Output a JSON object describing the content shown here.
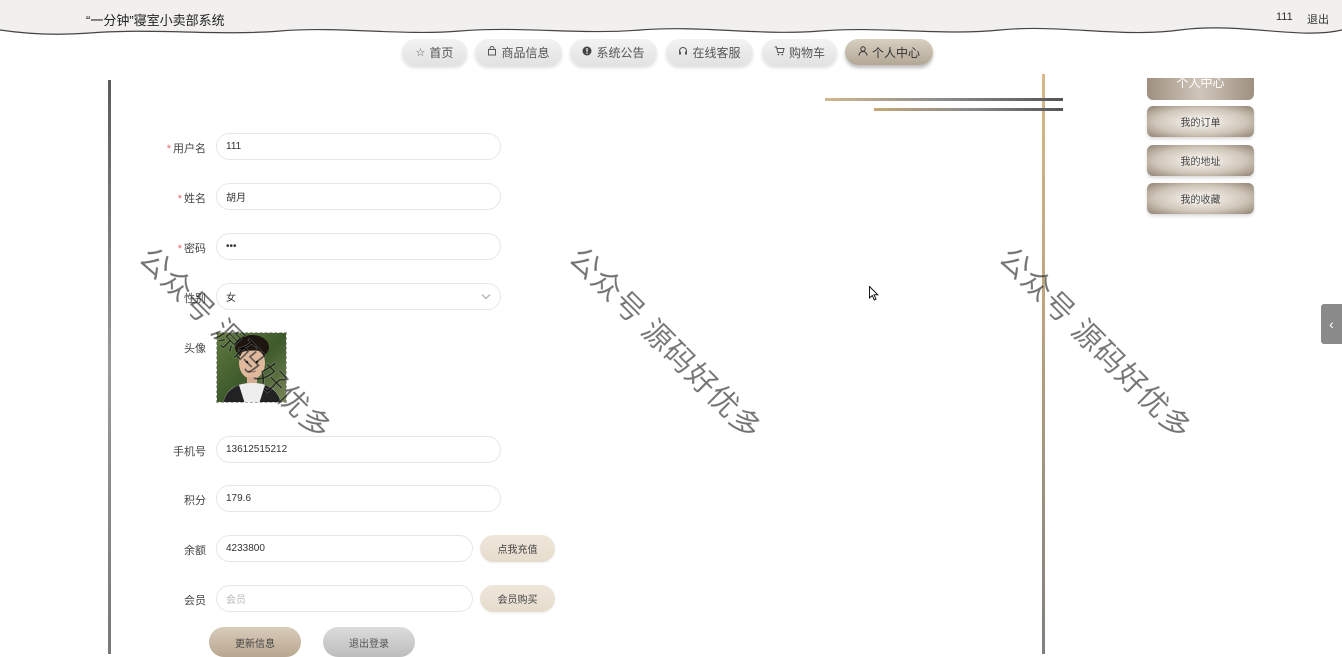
{
  "header": {
    "title": "“一分钟”寝室小卖部系统",
    "user": "111",
    "logout": "退出"
  },
  "nav": [
    {
      "label": "首页",
      "icon": "star-icon",
      "active": false
    },
    {
      "label": "商品信息",
      "icon": "bag-icon",
      "active": false
    },
    {
      "label": "系统公告",
      "icon": "info-icon",
      "active": false
    },
    {
      "label": "在线客服",
      "icon": "headset-icon",
      "active": false
    },
    {
      "label": "购物车",
      "icon": "cart-icon",
      "active": false
    },
    {
      "label": "个人中心",
      "icon": "user-icon",
      "active": true
    }
  ],
  "side_menu": {
    "title": "个人中心",
    "items": [
      "我的订单",
      "我的地址",
      "我的收藏"
    ]
  },
  "form": {
    "username": {
      "label": "用户名",
      "value": "111",
      "required": true
    },
    "name": {
      "label": "姓名",
      "value": "胡月",
      "required": true
    },
    "password": {
      "label": "密码",
      "value": "•••",
      "required": true
    },
    "gender": {
      "label": "性别",
      "value": "女"
    },
    "avatar": {
      "label": "头像"
    },
    "phone": {
      "label": "手机号",
      "value": "13612515212"
    },
    "points": {
      "label": "积分",
      "value": "179.6"
    },
    "balance": {
      "label": "余额",
      "value": "4233800",
      "action": "点我充值"
    },
    "member": {
      "label": "会员",
      "placeholder": "会员",
      "action": "会员购买"
    },
    "update_button": "更新信息",
    "logout_button": "退出登录"
  },
  "watermark": "公众号 源码好优多",
  "colors": {
    "accent": "#b8a68f",
    "required": "#e26b6b"
  }
}
